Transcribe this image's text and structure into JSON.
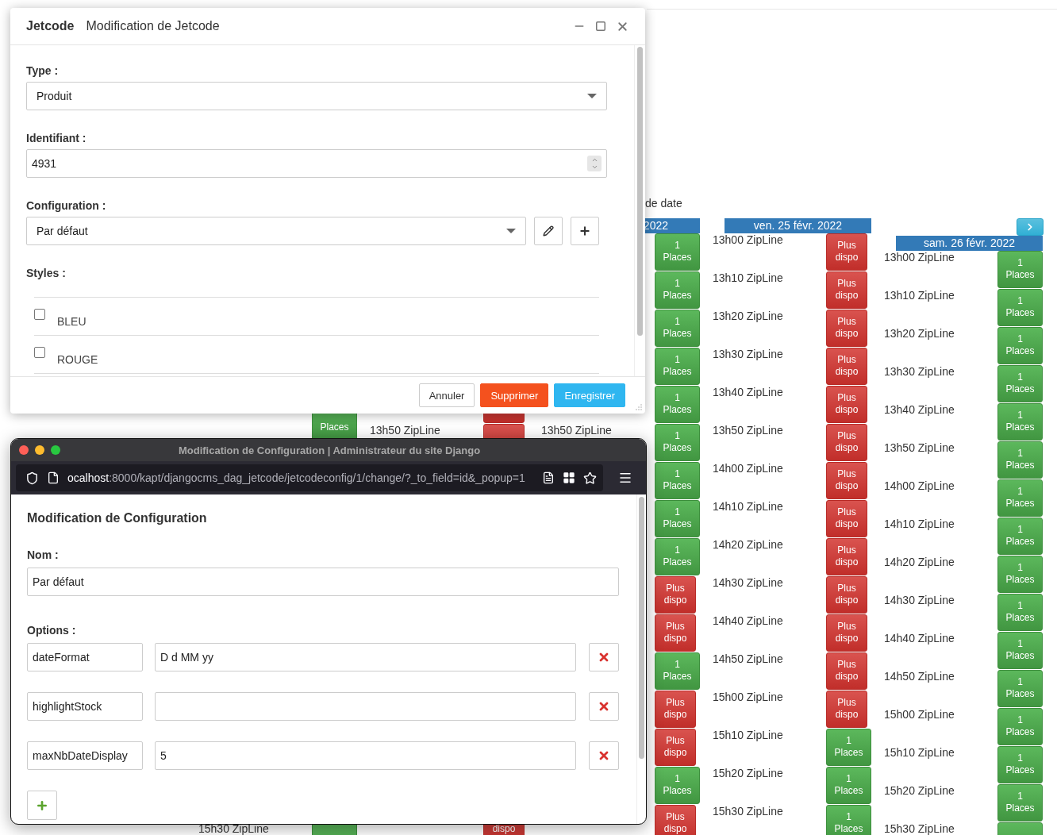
{
  "background": {
    "filter_label": "de date",
    "columns": [
      {
        "rows": [
          {},
          {},
          {},
          {},
          {
            "slot": {
              "kind": "places",
              "text": "Places"
            }
          },
          {},
          {},
          {},
          {},
          {},
          {},
          {},
          {},
          {},
          {},
          {
            "time": "15h30 ZipLine",
            "slot": {
              "kind": "places"
            }
          }
        ]
      },
      {
        "rows": [
          {},
          {},
          {},
          {},
          {
            "slot": {
              "kind": "full"
            }
          },
          {
            "time": "13h50 ZipLine",
            "slot": {
              "kind": "full"
            }
          },
          {},
          {},
          {},
          {},
          {},
          {},
          {},
          {},
          {},
          {
            "slot": {
              "kind": "full",
              "text": "dispo"
            }
          }
        ]
      },
      {
        "header": "2022",
        "rows": [
          {
            "slot": {
              "kind": "places",
              "text": "1 Places"
            }
          },
          {
            "slot": {
              "kind": "places",
              "text": "1 Places"
            }
          },
          {
            "slot": {
              "kind": "places",
              "text": "1 Places"
            }
          },
          {
            "slot": {
              "kind": "places",
              "text": "1 Places"
            }
          },
          {
            "slot": {
              "kind": "places",
              "text": "1 Places"
            }
          },
          {
            "time": "13h50 ZipLine",
            "slot": {
              "kind": "places",
              "text": "1 Places"
            }
          },
          {
            "slot": {
              "kind": "places",
              "text": "1 Places"
            }
          },
          {
            "slot": {
              "kind": "places",
              "text": "1 Places"
            }
          },
          {
            "slot": {
              "kind": "places",
              "text": "1 Places"
            }
          },
          {
            "slot": {
              "kind": "full",
              "text": "Plus dispo"
            }
          },
          {
            "slot": {
              "kind": "full",
              "text": "Plus dispo"
            }
          },
          {
            "slot": {
              "kind": "places",
              "text": "1 Places"
            }
          },
          {
            "slot": {
              "kind": "full",
              "text": "Plus dispo"
            }
          },
          {
            "slot": {
              "kind": "full",
              "text": "Plus dispo"
            }
          },
          {
            "slot": {
              "kind": "places",
              "text": "1 Places"
            }
          },
          {
            "slot": {
              "kind": "full",
              "text": "Plus dispo"
            }
          }
        ]
      },
      {
        "header": "ven. 25 févr. 2022",
        "rows": [
          {
            "time": "13h00 ZipLine",
            "slot": {
              "kind": "full",
              "text": "Plus dispo"
            }
          },
          {
            "time": "13h10 ZipLine",
            "slot": {
              "kind": "full",
              "text": "Plus dispo"
            }
          },
          {
            "time": "13h20 ZipLine",
            "slot": {
              "kind": "full",
              "text": "Plus dispo"
            }
          },
          {
            "time": "13h30 ZipLine",
            "slot": {
              "kind": "full",
              "text": "Plus dispo"
            }
          },
          {
            "time": "13h40 ZipLine",
            "slot": {
              "kind": "full",
              "text": "Plus dispo"
            }
          },
          {
            "time": "13h50 ZipLine",
            "slot": {
              "kind": "full",
              "text": "Plus dispo"
            }
          },
          {
            "time": "14h00 ZipLine",
            "slot": {
              "kind": "full",
              "text": "Plus dispo"
            }
          },
          {
            "time": "14h10 ZipLine",
            "slot": {
              "kind": "full",
              "text": "Plus dispo"
            }
          },
          {
            "time": "14h20 ZipLine",
            "slot": {
              "kind": "full",
              "text": "Plus dispo"
            }
          },
          {
            "time": "14h30 ZipLine",
            "slot": {
              "kind": "full",
              "text": "Plus dispo"
            }
          },
          {
            "time": "14h40 ZipLine",
            "slot": {
              "kind": "full",
              "text": "Plus dispo"
            }
          },
          {
            "time": "14h50 ZipLine",
            "slot": {
              "kind": "full",
              "text": "Plus dispo"
            }
          },
          {
            "time": "15h00 ZipLine",
            "slot": {
              "kind": "full",
              "text": "Plus dispo"
            }
          },
          {
            "time": "15h10 ZipLine",
            "slot": {
              "kind": "places",
              "text": "1 Places"
            }
          },
          {
            "time": "15h20 ZipLine",
            "slot": {
              "kind": "places",
              "text": "1 Places"
            }
          },
          {
            "time": "15h30 ZipLine",
            "slot": {
              "kind": "places",
              "text": "1 Places"
            }
          }
        ]
      },
      {
        "header": "sam. 26 févr. 2022",
        "next": true,
        "rows": [
          {
            "time": "13h00 ZipLine",
            "slot": {
              "kind": "places",
              "text": "1 Places"
            }
          },
          {
            "time": "13h10 ZipLine",
            "slot": {
              "kind": "places",
              "text": "1 Places"
            }
          },
          {
            "time": "13h20 ZipLine",
            "slot": {
              "kind": "places",
              "text": "1 Places"
            }
          },
          {
            "time": "13h30 ZipLine",
            "slot": {
              "kind": "places",
              "text": "1 Places"
            }
          },
          {
            "time": "13h40 ZipLine",
            "slot": {
              "kind": "places",
              "text": "1 Places"
            }
          },
          {
            "time": "13h50 ZipLine",
            "slot": {
              "kind": "places",
              "text": "1 Places"
            }
          },
          {
            "time": "14h00 ZipLine",
            "slot": {
              "kind": "places",
              "text": "1 Places"
            }
          },
          {
            "time": "14h10 ZipLine",
            "slot": {
              "kind": "places",
              "text": "1 Places"
            }
          },
          {
            "time": "14h20 ZipLine",
            "slot": {
              "kind": "places",
              "text": "1 Places"
            }
          },
          {
            "time": "14h30 ZipLine",
            "slot": {
              "kind": "places",
              "text": "1 Places"
            }
          },
          {
            "time": "14h40 ZipLine",
            "slot": {
              "kind": "places",
              "text": "1 Places"
            }
          },
          {
            "time": "14h50 ZipLine",
            "slot": {
              "kind": "places",
              "text": "1 Places"
            }
          },
          {
            "time": "15h00 ZipLine",
            "slot": {
              "kind": "places",
              "text": "1 Places"
            }
          },
          {
            "time": "15h10 ZipLine",
            "slot": {
              "kind": "places",
              "text": "1 Places"
            }
          },
          {
            "time": "15h20 ZipLine",
            "slot": {
              "kind": "places",
              "text": "1 Places"
            }
          },
          {
            "time": "15h30 ZipLine",
            "slot": {
              "kind": "places"
            }
          }
        ]
      }
    ]
  },
  "jetcode_dialog": {
    "brand": "Jetcode",
    "title": "Modification de Jetcode",
    "type_label": "Type :",
    "type_value": "Produit",
    "id_label": "Identifiant :",
    "id_value": "4931",
    "config_label": "Configuration :",
    "config_value": "Par défaut",
    "styles_label": "Styles :",
    "styles": [
      {
        "label": "BLEU",
        "checked": false
      },
      {
        "label": "ROUGE",
        "checked": false
      }
    ],
    "buttons": [
      {
        "label": "Annuler",
        "kind": "default"
      },
      {
        "label": "Supprimer",
        "kind": "danger"
      },
      {
        "label": "Enregistrer",
        "kind": "primary"
      }
    ]
  },
  "config_window": {
    "title": "Modification de Configuration | Administrateur du site Django",
    "url_host": "ocalhost",
    "url_path": ":8000/kapt/djangocms_dag_jetcode/jetcodeconfig/1/change/?_to_field=id&_popup=1",
    "heading": "Modification de Configuration",
    "name_label": "Nom :",
    "name_value": "Par défaut",
    "options_label": "Options :",
    "options": [
      {
        "key": "dateFormat",
        "value": "D d MM yy"
      },
      {
        "key": "highlightStock"
      },
      {
        "key": "maxNbDateDisplay",
        "value": "5"
      }
    ]
  }
}
